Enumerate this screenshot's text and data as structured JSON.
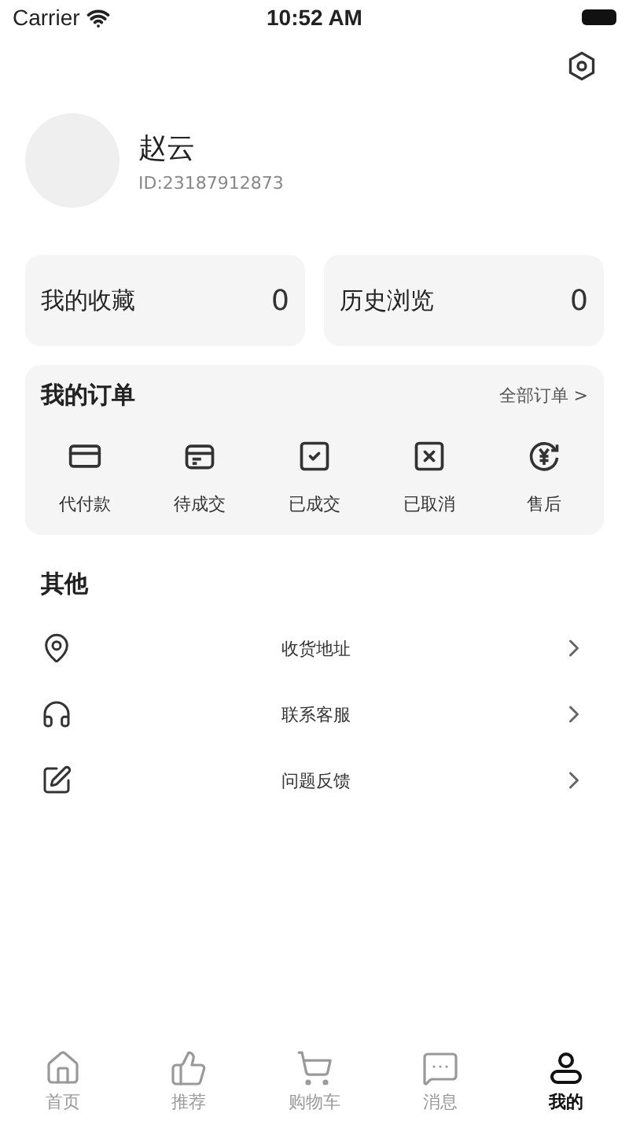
{
  "status_bar": {
    "carrier": "Carrier",
    "time": "10:52 AM"
  },
  "profile": {
    "name": "赵云",
    "id": "ID:23187912873"
  },
  "stats": [
    {
      "label": "我的收藏",
      "count": "0"
    },
    {
      "label": "历史浏览",
      "count": "0"
    }
  ],
  "orders": {
    "title": "我的订单",
    "all_link": "全部订单 >",
    "items": [
      {
        "kind": "pay",
        "label": "代付款"
      },
      {
        "kind": "pending",
        "label": "待成交"
      },
      {
        "kind": "done",
        "label": "已成交"
      },
      {
        "kind": "cancel",
        "label": "已取消"
      },
      {
        "kind": "refund",
        "label": "售后"
      }
    ]
  },
  "other": {
    "title": "其他",
    "items": [
      {
        "kind": "address",
        "label": "收货地址"
      },
      {
        "kind": "service",
        "label": "联系客服"
      },
      {
        "kind": "feedback",
        "label": "问题反馈"
      }
    ]
  },
  "tab_bar": [
    {
      "kind": "home",
      "label": "首页",
      "selected": false
    },
    {
      "kind": "recommend",
      "label": "推荐",
      "selected": false
    },
    {
      "kind": "cart",
      "label": "购物车",
      "selected": false
    },
    {
      "kind": "message",
      "label": "消息",
      "selected": false
    },
    {
      "kind": "me",
      "label": "我的",
      "selected": true
    }
  ]
}
